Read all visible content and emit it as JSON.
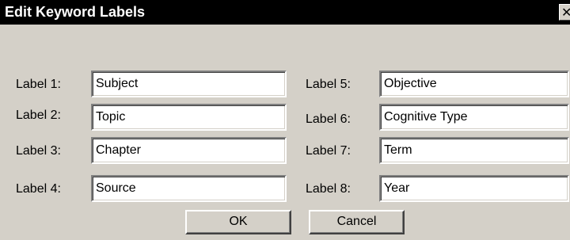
{
  "window": {
    "title": "Edit Keyword Labels",
    "close_glyph": "✕"
  },
  "fields_left": [
    {
      "label": "Label 1:",
      "value": "Subject"
    },
    {
      "label": "Label 2:",
      "value": "Topic"
    },
    {
      "label": "Label 3:",
      "value": "Chapter"
    },
    {
      "label": "Label 4:",
      "value": "Source"
    }
  ],
  "fields_right": [
    {
      "label": "Label 5:",
      "value": "Objective"
    },
    {
      "label": "Label 6:",
      "value": "Cognitive Type"
    },
    {
      "label": "Label 7:",
      "value": "Term"
    },
    {
      "label": "Label 8:",
      "value": "Year"
    }
  ],
  "buttons": {
    "ok": "OK",
    "cancel": "Cancel"
  }
}
